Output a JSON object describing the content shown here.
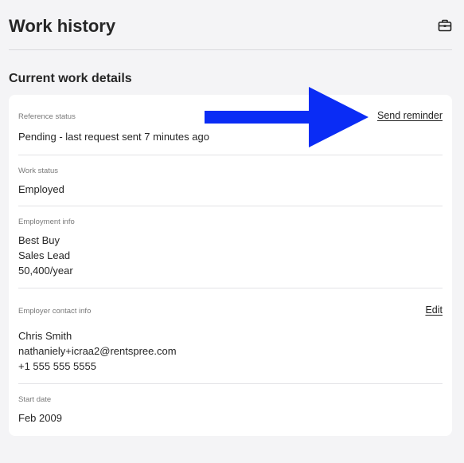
{
  "header": {
    "title": "Work history",
    "icon": "briefcase-icon"
  },
  "section": {
    "title": "Current work details"
  },
  "reference_status": {
    "label": "Reference status",
    "value": "Pending - last request sent 7 minutes ago",
    "action_label": "Send reminder"
  },
  "work_status": {
    "label": "Work status",
    "value": "Employed"
  },
  "employment_info": {
    "label": "Employment info",
    "employer": "Best Buy",
    "position": "Sales Lead",
    "salary": "50,400/year"
  },
  "employer_contact": {
    "label": "Employer contact info",
    "action_label": "Edit",
    "name": "Chris Smith",
    "email": "nathaniely+icraa2@rentspree.com",
    "phone": "+1 555 555 5555"
  },
  "start_date": {
    "label": "Start date",
    "value": "Feb 2009"
  },
  "annotation": {
    "arrow_color": "#0a2cf5"
  }
}
